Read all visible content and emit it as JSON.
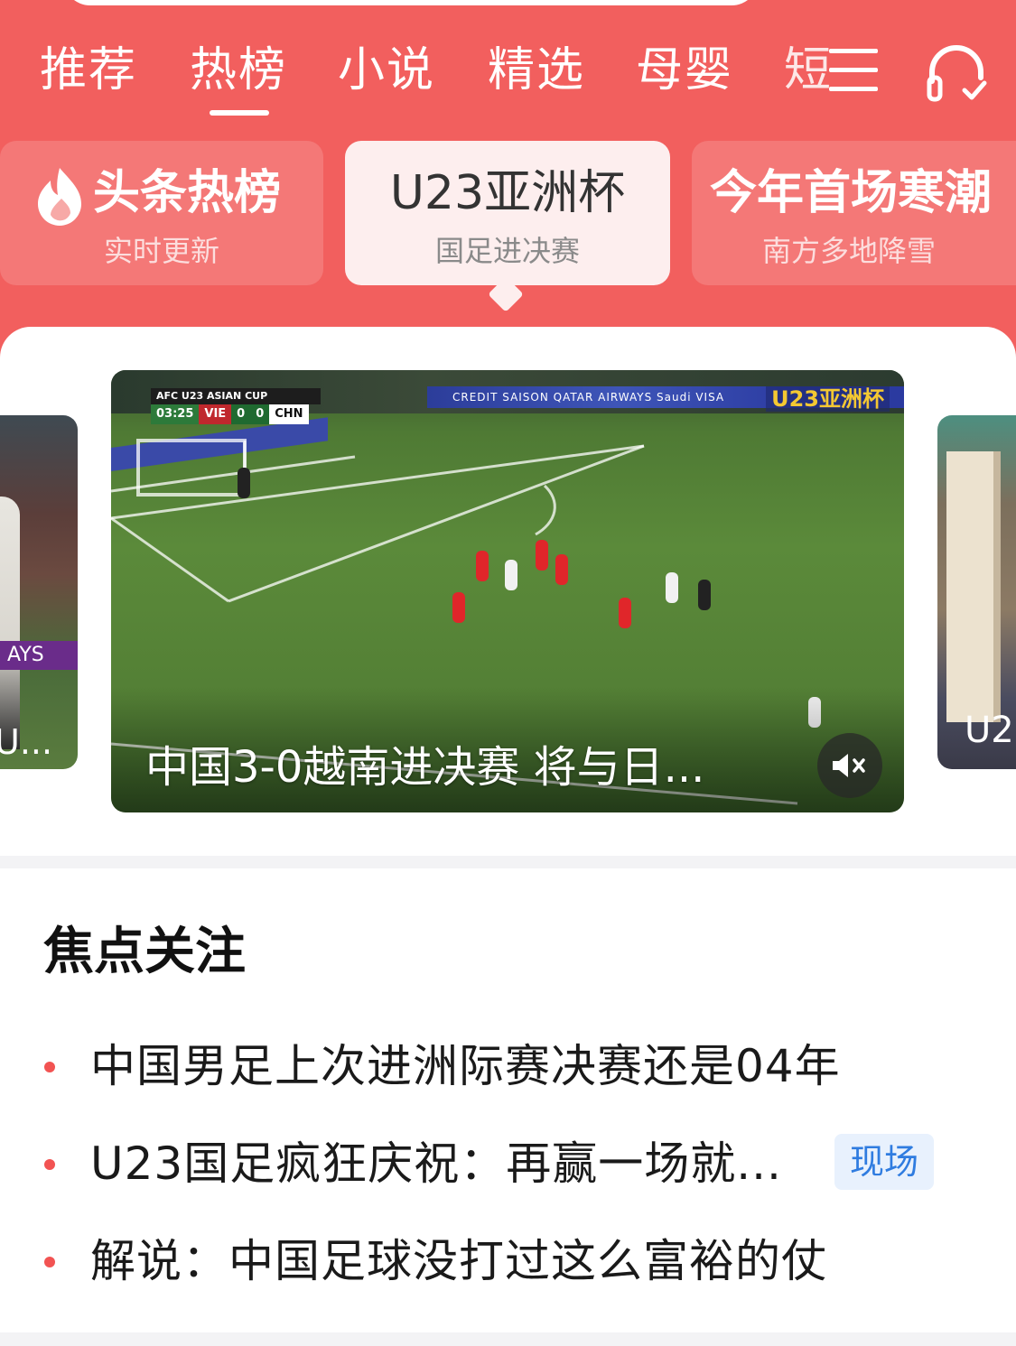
{
  "colors": {
    "header_red": "#f25f5e",
    "bullet_red": "#f25352",
    "tag_blue": "#2f7ce0",
    "tag_bg": "#e8f1fd"
  },
  "tabs": [
    {
      "label": "推荐",
      "active": false
    },
    {
      "label": "热榜",
      "active": true
    },
    {
      "label": "小说",
      "active": false
    },
    {
      "label": "精选",
      "active": false
    },
    {
      "label": "母婴",
      "active": false
    },
    {
      "label": "短",
      "active": false
    }
  ],
  "header_icons": {
    "menu": "menu-icon",
    "audio": "headphone-icon"
  },
  "hot_cards": [
    {
      "title": "头条热榜",
      "subtitle": "实时更新",
      "icon": "flame-icon"
    },
    {
      "title": "U23亚洲杯",
      "subtitle": "国足进决赛",
      "active": true
    },
    {
      "title": "今年首场寒潮",
      "subtitle": "南方多地降雪"
    }
  ],
  "carousel": {
    "left_caption": "U...",
    "right_caption": "U2",
    "main": {
      "title": "中国3-0越南进决赛 将与日...",
      "mute_icon": "mute-icon",
      "scoreboard": {
        "competition": "AFC U23 ASIAN CUP",
        "time": "03:25",
        "home": "VIE",
        "home_score": "0",
        "away_score": "0",
        "away": "CHN"
      },
      "corner_logo": "U23亚洲杯",
      "adboard": "CREDIT SAISON  QATAR AIRWAYS  Saudi  VISA"
    }
  },
  "focus": {
    "title": "焦点关注",
    "items": [
      {
        "text": "中国男足上次进洲际赛决赛还是04年",
        "tag": ""
      },
      {
        "text": "U23国足疯狂庆祝：再赢一场就...",
        "tag": "现场"
      },
      {
        "text": "解说：中国足球没打过这么富裕的仗",
        "tag": ""
      }
    ]
  }
}
